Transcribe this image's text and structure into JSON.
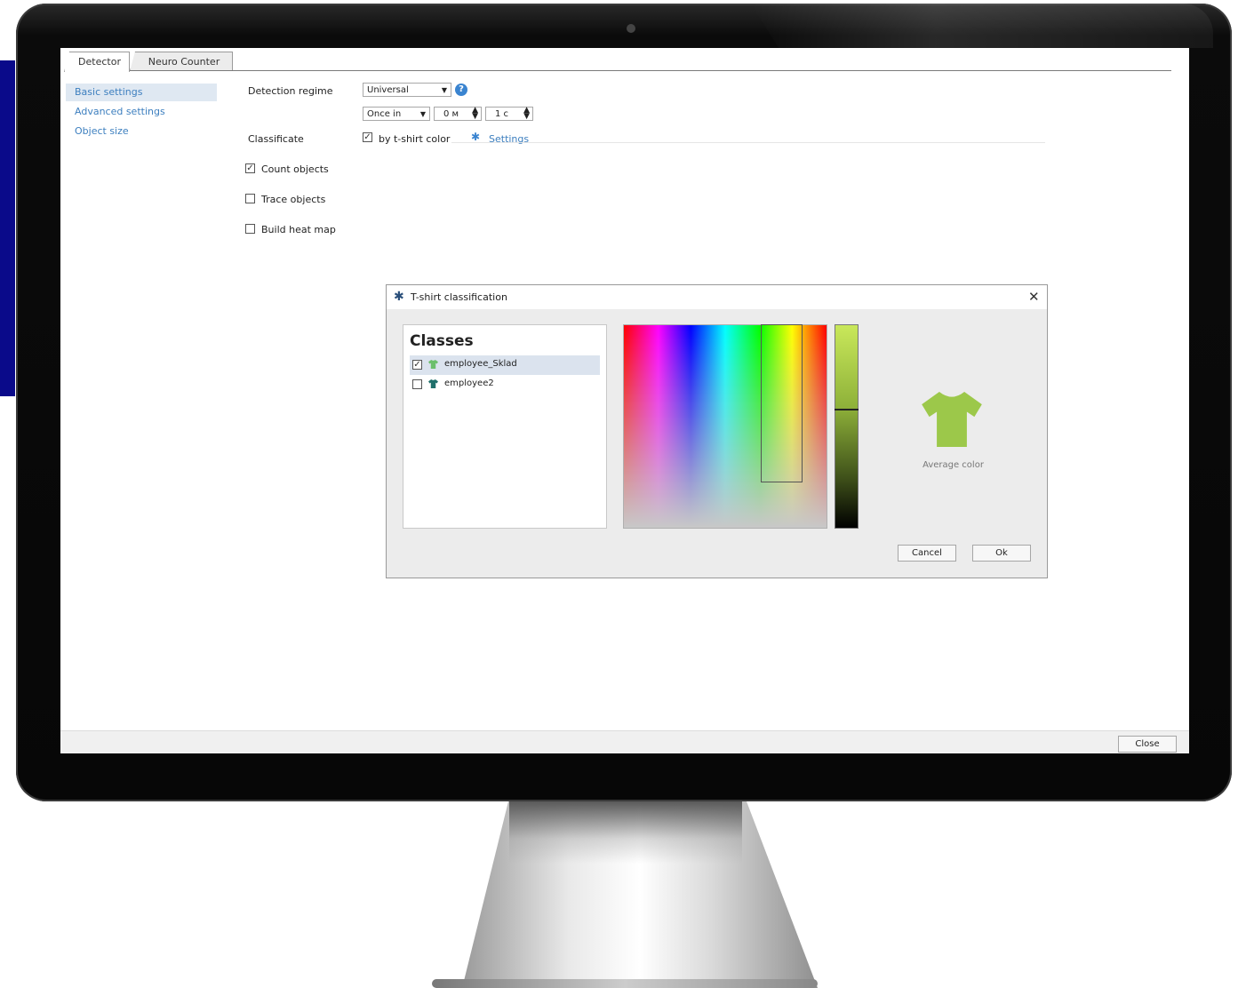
{
  "tabs": [
    {
      "label": "Detector"
    },
    {
      "label": "Neuro Counter"
    }
  ],
  "nav": {
    "items": [
      {
        "label": "Basic settings"
      },
      {
        "label": "Advanced settings"
      },
      {
        "label": "Object size"
      }
    ]
  },
  "settings": {
    "detection_regime_label": "Detection regime",
    "detection_regime_value": "Universal",
    "frequency_value": "Once in",
    "minutes_value": "0 м",
    "seconds_value": "1 с",
    "classificate_label": "Classificate",
    "by_tshirt_label": "by t-shirt color",
    "settings_link": "Settings",
    "count_objects_label": "Count objects",
    "count_objects_checked": true,
    "trace_objects_label": "Trace objects",
    "trace_objects_checked": false,
    "build_heat_map_label": "Build heat map",
    "build_heat_map_checked": false
  },
  "dialog": {
    "title": "T-shirt classification",
    "classes_title": "Classes",
    "classes": [
      {
        "name": "employee_Sklad",
        "checked": true,
        "color": "#6cbf6c"
      },
      {
        "name": "employee2",
        "checked": false,
        "color": "#1f6f6a"
      }
    ],
    "average_color_label": "Average color",
    "average_color": "#9cc84a",
    "cancel_label": "Cancel",
    "ok_label": "Ok"
  },
  "footer": {
    "close_label": "Close"
  }
}
